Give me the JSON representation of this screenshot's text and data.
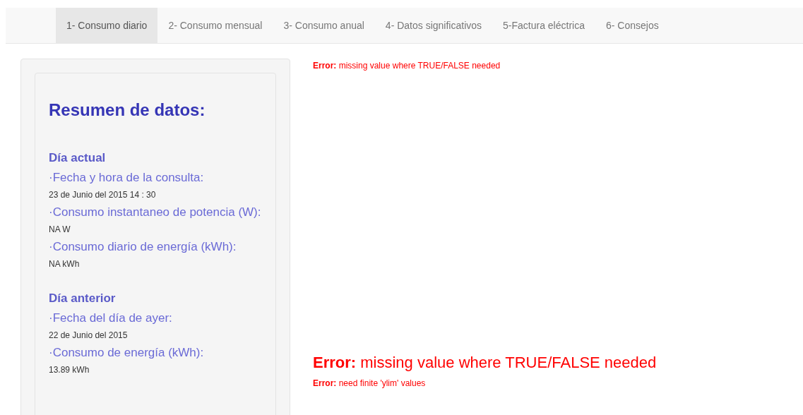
{
  "tabs": [
    {
      "label": "1- Consumo diario",
      "selected": true
    },
    {
      "label": "2- Consumo mensual",
      "selected": false
    },
    {
      "label": "3- Consumo anual",
      "selected": false
    },
    {
      "label": "4- Datos significativos",
      "selected": false
    },
    {
      "label": "5-Factura eléctrica",
      "selected": false
    },
    {
      "label": "6- Consejos",
      "selected": false
    }
  ],
  "sidebar": {
    "title": "Resumen de datos:",
    "sections": [
      {
        "heading": "Día actual",
        "items": [
          {
            "label": "·Fecha y hora de la consulta:",
            "value": "23 de Junio del 2015 14 : 30"
          },
          {
            "label": "·Consumo instantaneo de potencia (W):",
            "value": "NA W"
          },
          {
            "label": "·Consumo diario de energía (kWh):",
            "value": "NA kWh"
          }
        ]
      },
      {
        "heading": "Día anterior",
        "items": [
          {
            "label": "·Fecha del día de ayer:",
            "value": "22 de Junio del 2015"
          },
          {
            "label": "·Consumo de energía (kWh):",
            "value": "13.89 kWh"
          }
        ]
      }
    ]
  },
  "errors": [
    {
      "kind": "small",
      "text": "**Error:** missing value where TRUE/FALSE needed"
    },
    {
      "kind": "large",
      "text": "**Error:** missing value where TRUE/FALSE needed"
    },
    {
      "kind": "small",
      "text": "**Error:** need finite 'ylim' values"
    }
  ]
}
